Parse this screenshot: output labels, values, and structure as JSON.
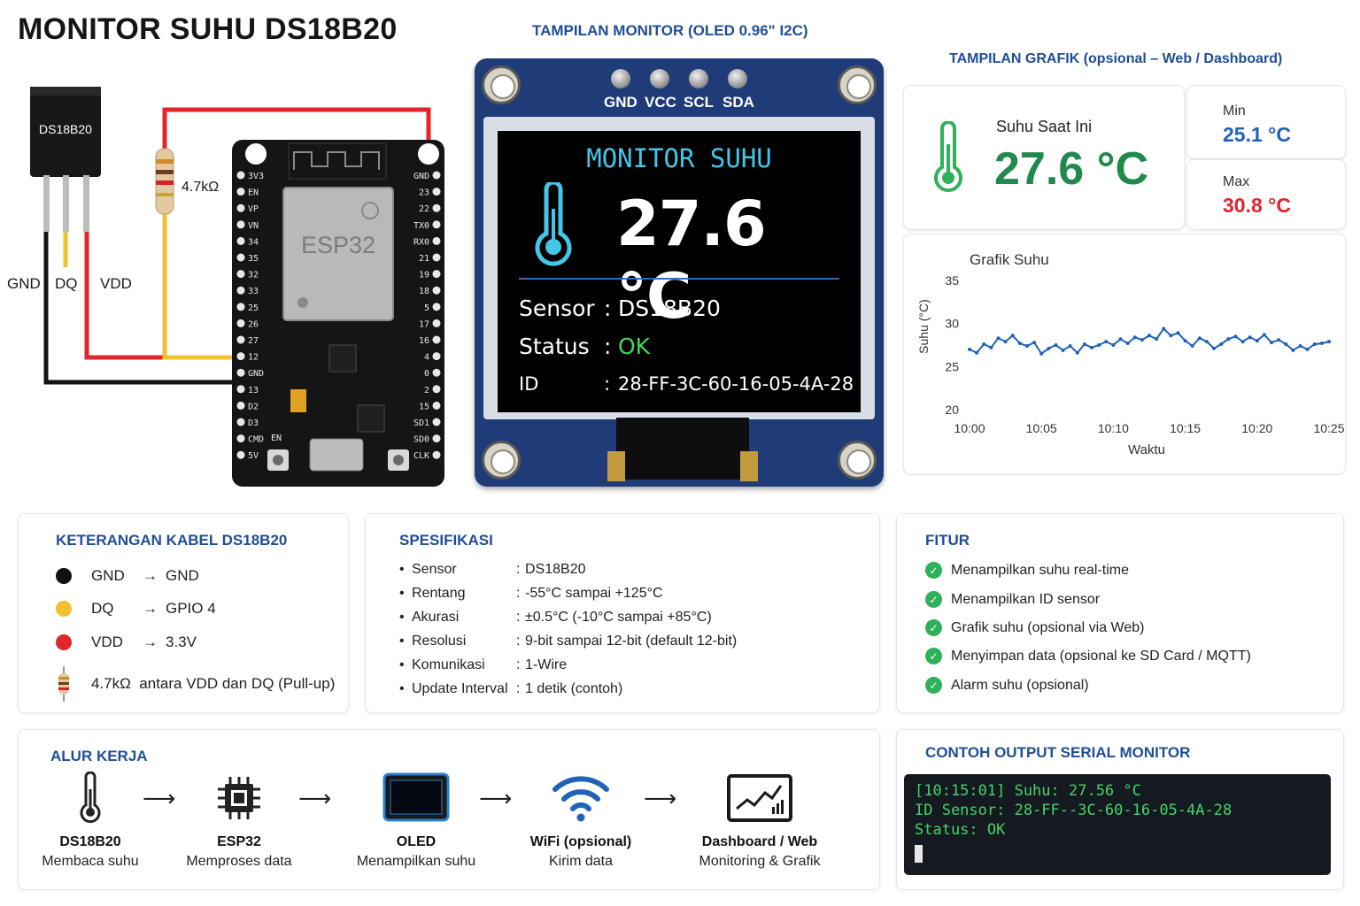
{
  "title": "MONITOR SUHU DS18B20",
  "wiring": {
    "sensor_label": "DS18B20",
    "sensor_pins": [
      "GND",
      "DQ",
      "VDD"
    ],
    "resistor_label": "4.7kΩ",
    "board_label": "ESP32",
    "pins_left": [
      "3V3",
      "EN",
      "VP",
      "VN",
      "34",
      "35",
      "32",
      "33",
      "25",
      "26",
      "27",
      "12",
      "GND",
      "13",
      "D2",
      "D3",
      "CMD",
      "5V"
    ],
    "pins_right": [
      "GND",
      "23",
      "22",
      "TX0",
      "RX0",
      "21",
      "19",
      "18",
      "5",
      "17",
      "16",
      "4",
      "0",
      "2",
      "15",
      "SD1",
      "SD0",
      "CLK"
    ],
    "en_label": "EN"
  },
  "oled": {
    "section_title": "TAMPILAN MONITOR (OLED 0.96\" I2C)",
    "pins": [
      "GND",
      "VCC",
      "SCL",
      "SDA"
    ],
    "screen_title": "MONITOR SUHU",
    "temperature": "27.6 °C",
    "rows": [
      {
        "key": "Sensor",
        "sep": ":",
        "value": "DS18B20"
      },
      {
        "key": "Status",
        "sep": ":",
        "value": "OK"
      },
      {
        "key": "ID",
        "sep": ":",
        "value": "28-FF-3C-60-16-05-4A-28"
      }
    ],
    "colors": {
      "title": "#45c6e8",
      "status_ok": "#3ddc5a",
      "board": "#1f3b78"
    }
  },
  "dashboard": {
    "section_title": "TAMPILAN GRAFIK",
    "section_subtitle": "(opsional – Web / Dashboard)",
    "current_label": "Suhu Saat Ini",
    "current_value": "27.6 °C",
    "min_label": "Min",
    "min_value": "25.1 °C",
    "max_label": "Max",
    "max_value": "30.8 °C",
    "colors": {
      "current": "#1f8a4c",
      "min": "#1f63b8",
      "max": "#e0262b"
    }
  },
  "chart_data": {
    "type": "line",
    "title": "Grafik Suhu",
    "xlabel": "Waktu",
    "ylabel": "Suhu (°C)",
    "x_tick_labels": [
      "10:00",
      "10:05",
      "10:10",
      "10:15",
      "10:20",
      "10:25"
    ],
    "xlim": [
      0,
      25
    ],
    "ylim": [
      20,
      35
    ],
    "y_ticks": [
      20,
      25,
      30,
      35
    ],
    "grid": false,
    "series": [
      {
        "color": "#1f63b8",
        "x": [
          0,
          0.5,
          1,
          1.5,
          2,
          2.5,
          3,
          3.5,
          4,
          4.5,
          5,
          5.5,
          6,
          6.5,
          7,
          7.5,
          8,
          8.5,
          9,
          9.5,
          10,
          10.5,
          11,
          11.5,
          12,
          12.5,
          13,
          13.5,
          14,
          14.5,
          15,
          15.5,
          16,
          16.5,
          17,
          17.5,
          18,
          18.5,
          19,
          19.5,
          20,
          20.5,
          21,
          21.5,
          22,
          22.5,
          23,
          23.5,
          24,
          24.5,
          25
        ],
        "values": [
          27.0,
          26.6,
          27.6,
          27.2,
          28.3,
          27.9,
          28.6,
          27.7,
          27.4,
          27.8,
          26.5,
          27.1,
          27.5,
          26.9,
          27.4,
          26.6,
          27.6,
          27.2,
          27.5,
          27.9,
          27.5,
          28.2,
          27.7,
          28.4,
          28.1,
          28.6,
          28.2,
          29.4,
          28.6,
          28.9,
          28.0,
          27.4,
          28.3,
          27.9,
          27.1,
          27.6,
          28.2,
          28.5,
          27.9,
          28.4,
          28.0,
          28.7,
          27.8,
          28.1,
          27.6,
          26.9,
          27.4,
          27.0,
          27.6,
          27.7,
          27.9
        ]
      }
    ]
  },
  "cable_legend": {
    "title": "KETERANGAN KABEL DS18B20",
    "rows": [
      {
        "name": "GND",
        "arrow": "→",
        "target": "GND",
        "color": "#111111"
      },
      {
        "name": "DQ",
        "arrow": "→",
        "target": "GPIO 4",
        "color": "#f2c12e"
      },
      {
        "name": "VDD",
        "arrow": "→",
        "target": "3.3V",
        "color": "#e0262b"
      }
    ],
    "resistor_note": "4.7kΩ  antara VDD dan DQ (Pull-up)"
  },
  "spec": {
    "title": "SPESIFIKASI",
    "rows": [
      {
        "bullet": "•",
        "key": "Sensor",
        "sep": ":",
        "value": "DS18B20"
      },
      {
        "bullet": "•",
        "key": "Rentang",
        "sep": ":",
        "value": "-55°C sampai +125°C"
      },
      {
        "bullet": "•",
        "key": "Akurasi",
        "sep": ":",
        "value": "±0.5°C (-10°C sampai +85°C)"
      },
      {
        "bullet": "•",
        "key": "Resolusi",
        "sep": ":",
        "value": "9-bit sampai 12-bit (default 12-bit)"
      },
      {
        "bullet": "•",
        "key": "Komunikasi",
        "sep": ":",
        "value": "1-Wire"
      },
      {
        "bullet": "•",
        "key": "Update Interval",
        "sep": ":",
        "value": "1 detik (contoh)"
      }
    ]
  },
  "fitur": {
    "title": "FITUR",
    "items": [
      "Menampilkan suhu real-time",
      "Menampilkan ID sensor",
      "Grafik suhu (opsional via Web)",
      "Menyimpan data (opsional ke SD Card / MQTT)",
      "Alarm suhu (opsional)"
    ],
    "check_glyph": "✓"
  },
  "flow": {
    "title": "ALUR KERJA",
    "arrow": "⟶",
    "steps": [
      {
        "title": "DS18B20",
        "sub": "Membaca suhu",
        "icon": "thermometer-icon"
      },
      {
        "title": "ESP32",
        "sub": "Memproses data",
        "icon": "chip-icon"
      },
      {
        "title": "OLED",
        "sub": "Menampilkan suhu",
        "icon": "display-icon"
      },
      {
        "title": "WiFi (opsional)",
        "sub": "Kirim data",
        "icon": "wifi-icon"
      },
      {
        "title": "Dashboard / Web",
        "sub": "Monitoring & Grafik",
        "icon": "chart-monitor-icon"
      }
    ]
  },
  "serial": {
    "title": "CONTOH OUTPUT SERIAL MONITOR",
    "lines": [
      "[10:15:01] Suhu: 27.56 °C",
      "ID Sensor: 28-FF--3C-60-16-05-4A-28",
      "Status: OK"
    ]
  }
}
